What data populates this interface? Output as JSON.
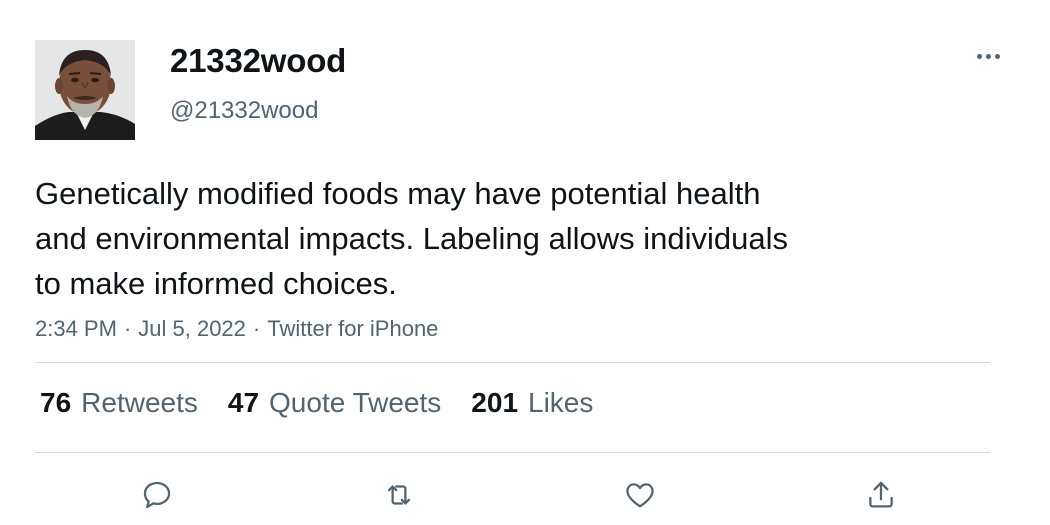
{
  "user": {
    "display_name": "21332wood",
    "handle": "@21332wood"
  },
  "tweet": {
    "text": "Genetically modified foods may have potential health\nand environmental impacts. Labeling allows individuals\nto make informed choices.",
    "time": "2:34 PM",
    "date": "Jul 5, 2022",
    "source": "Twitter for iPhone",
    "separator": "·"
  },
  "stats": {
    "retweets": {
      "count": "76",
      "label": "Retweets"
    },
    "quotes": {
      "count": "47",
      "label": "Quote Tweets"
    },
    "likes": {
      "count": "201",
      "label": "Likes"
    }
  },
  "icons": {
    "more": "more-horizontal-icon",
    "reply": "reply-icon",
    "retweet": "retweet-icon",
    "like": "like-icon",
    "share": "share-icon"
  },
  "colors": {
    "text": "#0f1419",
    "secondary": "#536471",
    "divider": "#cfd9de"
  }
}
